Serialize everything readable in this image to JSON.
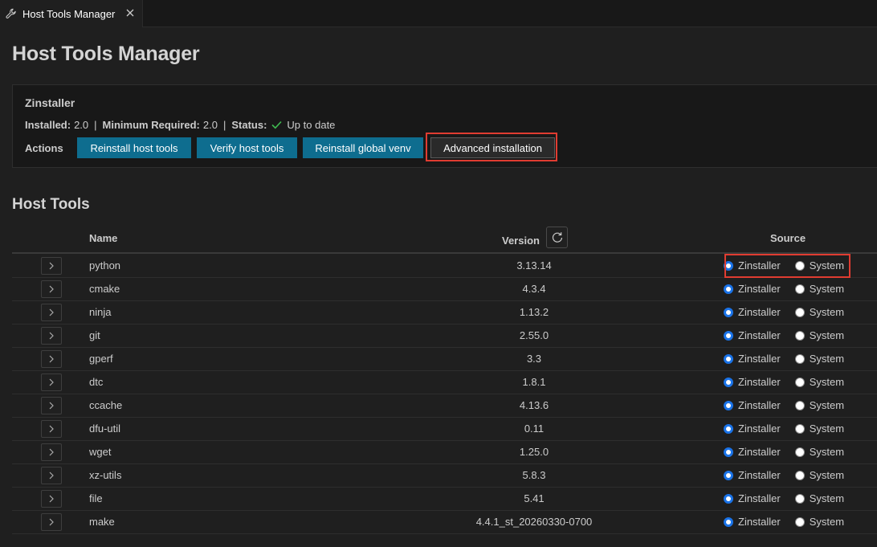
{
  "tab": {
    "title": "Host Tools Manager",
    "icon": "wrench-icon",
    "close_icon": "close-icon"
  },
  "page_title": "Host Tools Manager",
  "zinstaller": {
    "title": "Zinstaller",
    "installed_label": "Installed:",
    "installed_value": "2.0",
    "min_label": "Minimum Required:",
    "min_value": "2.0",
    "status_label": "Status:",
    "status_value": "Up to date",
    "actions_label": "Actions",
    "buttons": {
      "reinstall": "Reinstall host tools",
      "verify": "Verify host tools",
      "reinstall_venv": "Reinstall global venv",
      "advanced": "Advanced installation"
    }
  },
  "host_tools": {
    "title": "Host Tools",
    "columns": {
      "name": "Name",
      "version": "Version",
      "source": "Source"
    },
    "source_options": [
      "Zinstaller",
      "System"
    ],
    "rows": [
      {
        "name": "python",
        "version": "3.13.14",
        "source": "Zinstaller"
      },
      {
        "name": "cmake",
        "version": "4.3.4",
        "source": "Zinstaller"
      },
      {
        "name": "ninja",
        "version": "1.13.2",
        "source": "Zinstaller"
      },
      {
        "name": "git",
        "version": "2.55.0",
        "source": "Zinstaller"
      },
      {
        "name": "gperf",
        "version": "3.3",
        "source": "Zinstaller"
      },
      {
        "name": "dtc",
        "version": "1.8.1",
        "source": "Zinstaller"
      },
      {
        "name": "ccache",
        "version": "4.13.6",
        "source": "Zinstaller"
      },
      {
        "name": "dfu-util",
        "version": "0.11",
        "source": "Zinstaller"
      },
      {
        "name": "wget",
        "version": "1.25.0",
        "source": "Zinstaller"
      },
      {
        "name": "xz-utils",
        "version": "5.8.3",
        "source": "Zinstaller"
      },
      {
        "name": "file",
        "version": "5.41",
        "source": "Zinstaller"
      },
      {
        "name": "make",
        "version": "4.4.1_st_20260330-0700",
        "source": "Zinstaller"
      }
    ]
  },
  "colors": {
    "accent_button": "#0e6d8f",
    "highlight": "#e03c31",
    "check": "#3fb950",
    "radio_on": "#1a73e8"
  }
}
